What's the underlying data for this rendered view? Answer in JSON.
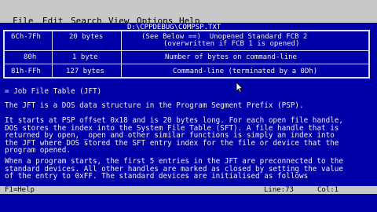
{
  "menu": [
    "File",
    "Edit",
    "Search",
    "View",
    "Options",
    "Help"
  ],
  "file_path": "D:\\CPPDEBUG\\COMPSP.TXT",
  "table_rows": [
    {
      "range": "6Ch-7Fh",
      "size": "20 bytes",
      "desc_line1": "(See Below ==)  Unopened Standard FCB 2",
      "desc_line2": "(overwritten if FCB 1 is opened)"
    },
    {
      "range": "80h",
      "size": "1 byte",
      "desc_line1": "Number of bytes on command-line",
      "desc_line2": ""
    },
    {
      "range": "81h-FFh",
      "size": "127 bytes",
      "desc_line1": "Command-line (terminated by a 0Dh)",
      "desc_line2": ""
    }
  ],
  "heading": "= Job File Table (JFT)",
  "paragraphs": [
    "The JFT is a DOS data structure in the Program Segment Prefix (PSP).",
    "It starts at PSP offset 0x18 and is 20 bytes long. For each open file handle,\nDOS stores the index into the System File Table (SFT). A file handle that is\nreturned by open, _open and other similar functions is simply an index into\nthe JFT where DOS stored the SFT entry index for the file or device that the\nprogram opened.",
    "When a program starts, the first 5 entries in the JFT are preconnected to the\nstandard devices. All other handles are marked as closed by setting the value\nof the entry to 0xFF. The standard devices are initialised as follows"
  ],
  "status": {
    "help": "F1=Help",
    "line": "Line:73",
    "col": "Col:1"
  }
}
